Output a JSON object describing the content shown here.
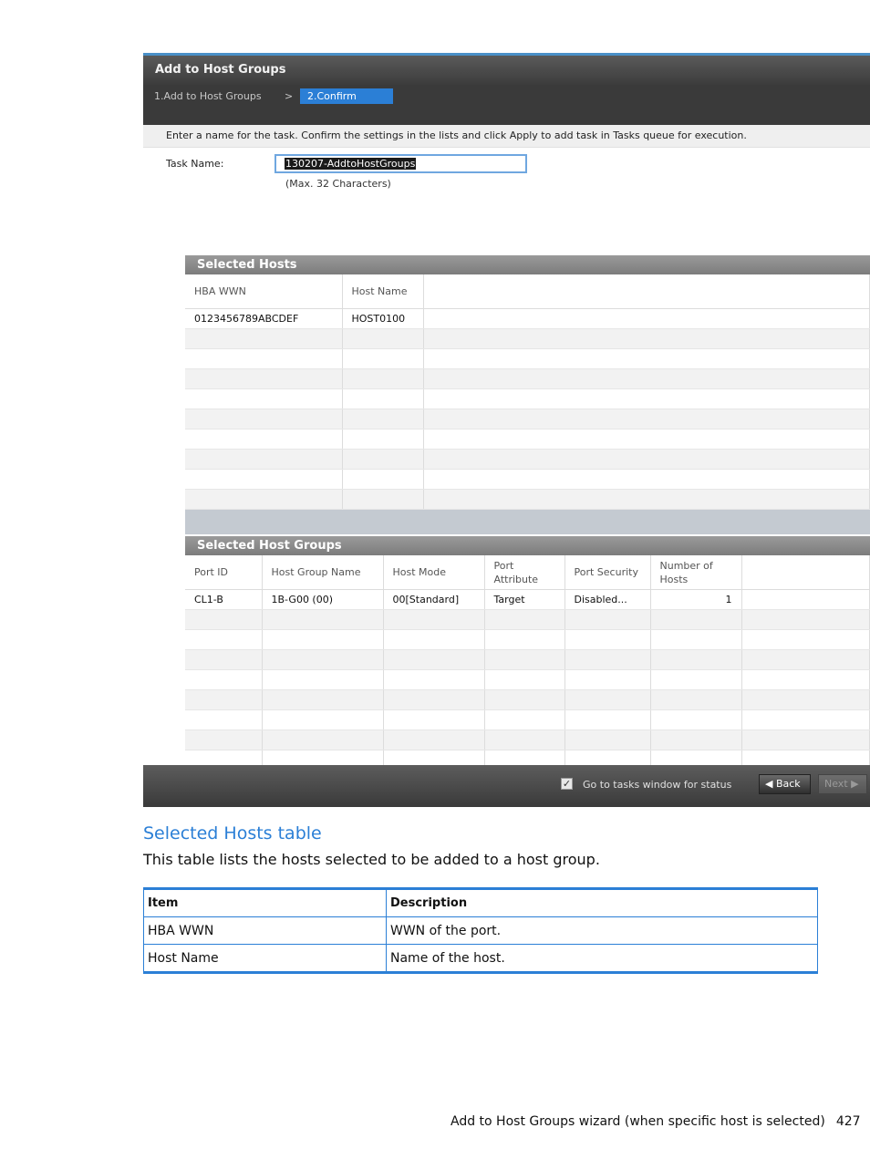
{
  "dialog": {
    "title": "Add to Host Groups",
    "steps": {
      "step1": "1.Add to Host Groups",
      "separator": ">",
      "step2": "2.Confirm"
    },
    "instructions": "Enter a name for the task. Confirm the settings in the lists and click Apply to add task in Tasks queue for execution.",
    "task_name_label": "Task Name:",
    "task_name_value": "130207-AddtoHostGroups",
    "task_name_hint": "(Max. 32 Characters)",
    "selected_hosts": {
      "title": "Selected Hosts",
      "columns": [
        "HBA WWN",
        "Host Name"
      ],
      "rows": [
        [
          "0123456789ABCDEF",
          "HOST0100"
        ]
      ]
    },
    "selected_host_groups": {
      "title": "Selected Host Groups",
      "columns": [
        "Port ID",
        "Host Group Name",
        "Host Mode",
        "Port Attribute",
        "Port Security",
        "Number of Hosts"
      ],
      "rows": [
        [
          "CL1-B",
          "1B-G00 (00)",
          "00[Standard]",
          "Target",
          "Disabled...",
          "1"
        ]
      ]
    },
    "footer": {
      "checkbox_checked": true,
      "checkbox_label": "Go to tasks window for status",
      "back_label": "Back",
      "next_label": "Next"
    }
  },
  "doc": {
    "section_title": "Selected Hosts table",
    "intro": "This table lists the hosts selected to be added to a host group.",
    "table": {
      "headers": [
        "Item",
        "Description"
      ],
      "rows": [
        [
          "HBA WWN",
          "WWN of the port."
        ],
        [
          "Host Name",
          "Name of the host."
        ]
      ]
    },
    "footer_text": "Add to Host Groups wizard (when specific host is selected)",
    "page_number": "427"
  }
}
